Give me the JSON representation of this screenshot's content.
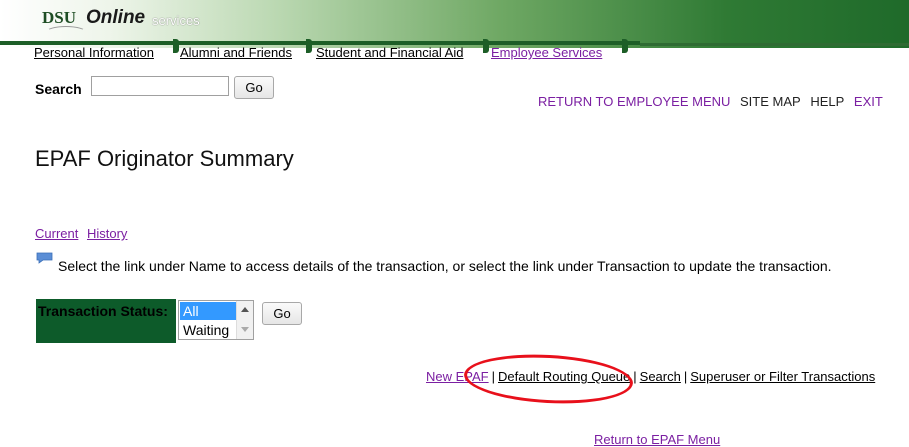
{
  "brand": {
    "dsu": "DSU",
    "online": "Online",
    "services": "services"
  },
  "tabs": [
    {
      "label": "Personal Information",
      "active": false
    },
    {
      "label": "Alumni and Friends",
      "active": false
    },
    {
      "label": "Student and Financial Aid",
      "active": false
    },
    {
      "label": "Employee Services",
      "active": true
    }
  ],
  "search": {
    "label": "Search",
    "value": "",
    "go_label": "Go"
  },
  "top_links": {
    "return_employee_menu": "RETURN TO EMPLOYEE MENU",
    "site_map": "SITE MAP",
    "help": "HELP",
    "exit": "EXIT"
  },
  "page_title": "EPAF Originator Summary",
  "view_links": {
    "current": "Current",
    "history": "History"
  },
  "info_text": "Select the link under Name to access details of the transaction, or select the link under Transaction to update the transaction.",
  "status": {
    "label": "Transaction Status:",
    "options": [
      "All",
      "Waiting"
    ],
    "selected": "All",
    "go_label": "Go"
  },
  "actions": {
    "new_epaf": "New EPAF",
    "default_routing_queue": "Default Routing Queue",
    "search": "Search",
    "superuser": "Superuser or Filter Transactions",
    "separator": "|"
  },
  "return_link": "Return to EPAF Menu",
  "colors": {
    "accent_green": "#0d5b2a",
    "link_purple": "#7b1fa2",
    "highlight_red": "#e8101b"
  }
}
